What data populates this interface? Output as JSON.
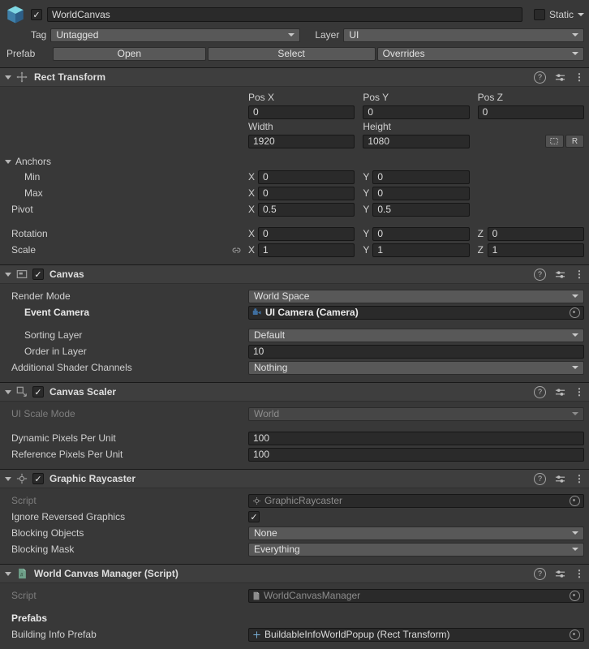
{
  "icons": {
    "help": "?",
    "kebab": "⋮"
  },
  "gameobject": {
    "name": "WorldCanvas",
    "static_label": "Static",
    "tag_label": "Tag",
    "tag_value": "Untagged",
    "layer_label": "Layer",
    "layer_value": "UI",
    "prefab_label": "Prefab",
    "open_label": "Open",
    "select_label": "Select",
    "overrides_label": "Overrides"
  },
  "axis": {
    "x": "X",
    "y": "Y",
    "z": "Z"
  },
  "rect_transform": {
    "title": "Rect Transform",
    "pos_x_label": "Pos X",
    "pos_y_label": "Pos Y",
    "pos_z_label": "Pos Z",
    "pos_x": "0",
    "pos_y": "0",
    "pos_z": "0",
    "width_label": "Width",
    "height_label": "Height",
    "width": "1920",
    "height": "1080",
    "raw_edit_label": "R",
    "anchors_label": "Anchors",
    "min_label": "Min",
    "min_x": "0",
    "min_y": "0",
    "max_label": "Max",
    "max_x": "0",
    "max_y": "0",
    "pivot_label": "Pivot",
    "pivot_x": "0.5",
    "pivot_y": "0.5",
    "rotation_label": "Rotation",
    "rotation_x": "0",
    "rotation_y": "0",
    "rotation_z": "0",
    "scale_label": "Scale",
    "scale_x": "1",
    "scale_y": "1",
    "scale_z": "1"
  },
  "canvas": {
    "title": "Canvas",
    "render_mode_label": "Render Mode",
    "render_mode_value": "World Space",
    "event_camera_label": "Event Camera",
    "event_camera_value": "UI Camera (Camera)",
    "sorting_layer_label": "Sorting Layer",
    "sorting_layer_value": "Default",
    "order_in_layer_label": "Order in Layer",
    "order_in_layer_value": "10",
    "shader_channels_label": "Additional Shader Channels",
    "shader_channels_value": "Nothing"
  },
  "canvas_scaler": {
    "title": "Canvas Scaler",
    "ui_scale_mode_label": "UI Scale Mode",
    "ui_scale_mode_value": "World",
    "dynamic_ppu_label": "Dynamic Pixels Per Unit",
    "dynamic_ppu_value": "100",
    "reference_ppu_label": "Reference Pixels Per Unit",
    "reference_ppu_value": "100"
  },
  "graphic_raycaster": {
    "title": "Graphic Raycaster",
    "script_label": "Script",
    "script_value": "GraphicRaycaster",
    "ignore_reversed_label": "Ignore Reversed Graphics",
    "blocking_objects_label": "Blocking Objects",
    "blocking_objects_value": "None",
    "blocking_mask_label": "Blocking Mask",
    "blocking_mask_value": "Everything"
  },
  "world_canvas_manager": {
    "title": "World Canvas Manager (Script)",
    "script_label": "Script",
    "script_value": "WorldCanvasManager",
    "prefabs_label": "Prefabs",
    "building_info_label": "Building Info Prefab",
    "building_info_value": "BuildableInfoWorldPopup (Rect Transform)"
  }
}
